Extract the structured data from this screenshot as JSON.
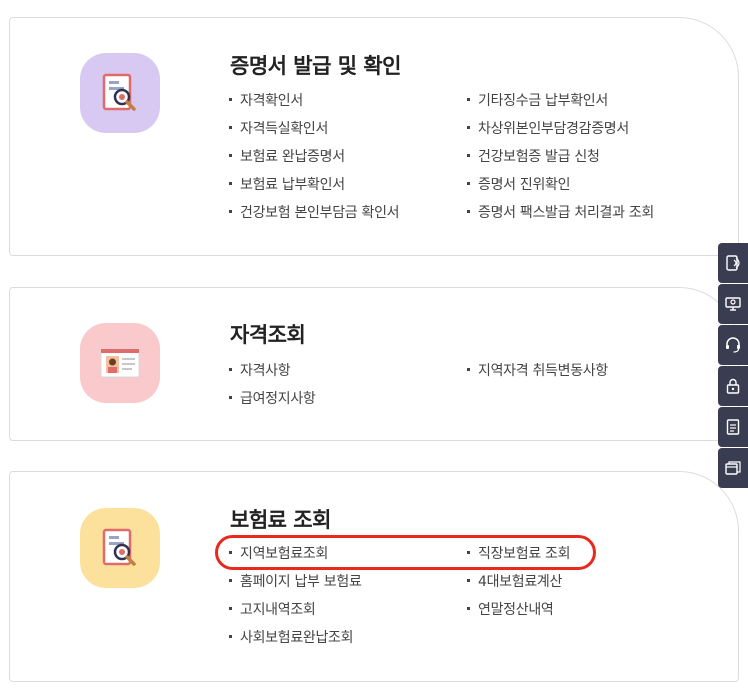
{
  "sections": [
    {
      "id": "certificate",
      "title": "증명서 발급 및 확인",
      "icon": "document-search-icon",
      "icon_bg": "#d8c9f2",
      "links": [
        [
          "자격확인서",
          "기타징수금 납부확인서"
        ],
        [
          "자격득실확인서",
          "차상위본인부담경감증명서"
        ],
        [
          "보험료 완납증명서",
          "건강보험증 발급 신청"
        ],
        [
          "보험료 납부확인서",
          "증명서 진위확인"
        ],
        [
          "건강보험 본인부담금 확인서",
          "증명서 팩스발급 처리결과 조회"
        ]
      ]
    },
    {
      "id": "qualification",
      "title": "자격조회",
      "icon": "id-card-icon",
      "icon_bg": "#f9c9cc",
      "links": [
        [
          "자격사항",
          "지역자격 취득변동사항"
        ],
        [
          "급여정지사항",
          null
        ]
      ]
    },
    {
      "id": "premium",
      "title": "보험료 조회",
      "icon": "document-search-icon",
      "icon_bg": "#fbe19c",
      "links": [
        [
          "지역보험료조회",
          "직장보험료 조회"
        ],
        [
          "홈페이지 납부 보험료",
          "4대보험료계산"
        ],
        [
          "고지내역조회",
          "연말정산내역"
        ],
        [
          "사회보험료완납조회",
          null
        ]
      ]
    }
  ],
  "highlight_color": "#e8291c",
  "quick_menu": [
    {
      "icon": "phone-tablet-icon"
    },
    {
      "icon": "monitor-user-icon"
    },
    {
      "icon": "headset-icon"
    },
    {
      "icon": "lock-icon"
    },
    {
      "icon": "document-list-icon"
    },
    {
      "icon": "browser-windows-icon"
    }
  ]
}
